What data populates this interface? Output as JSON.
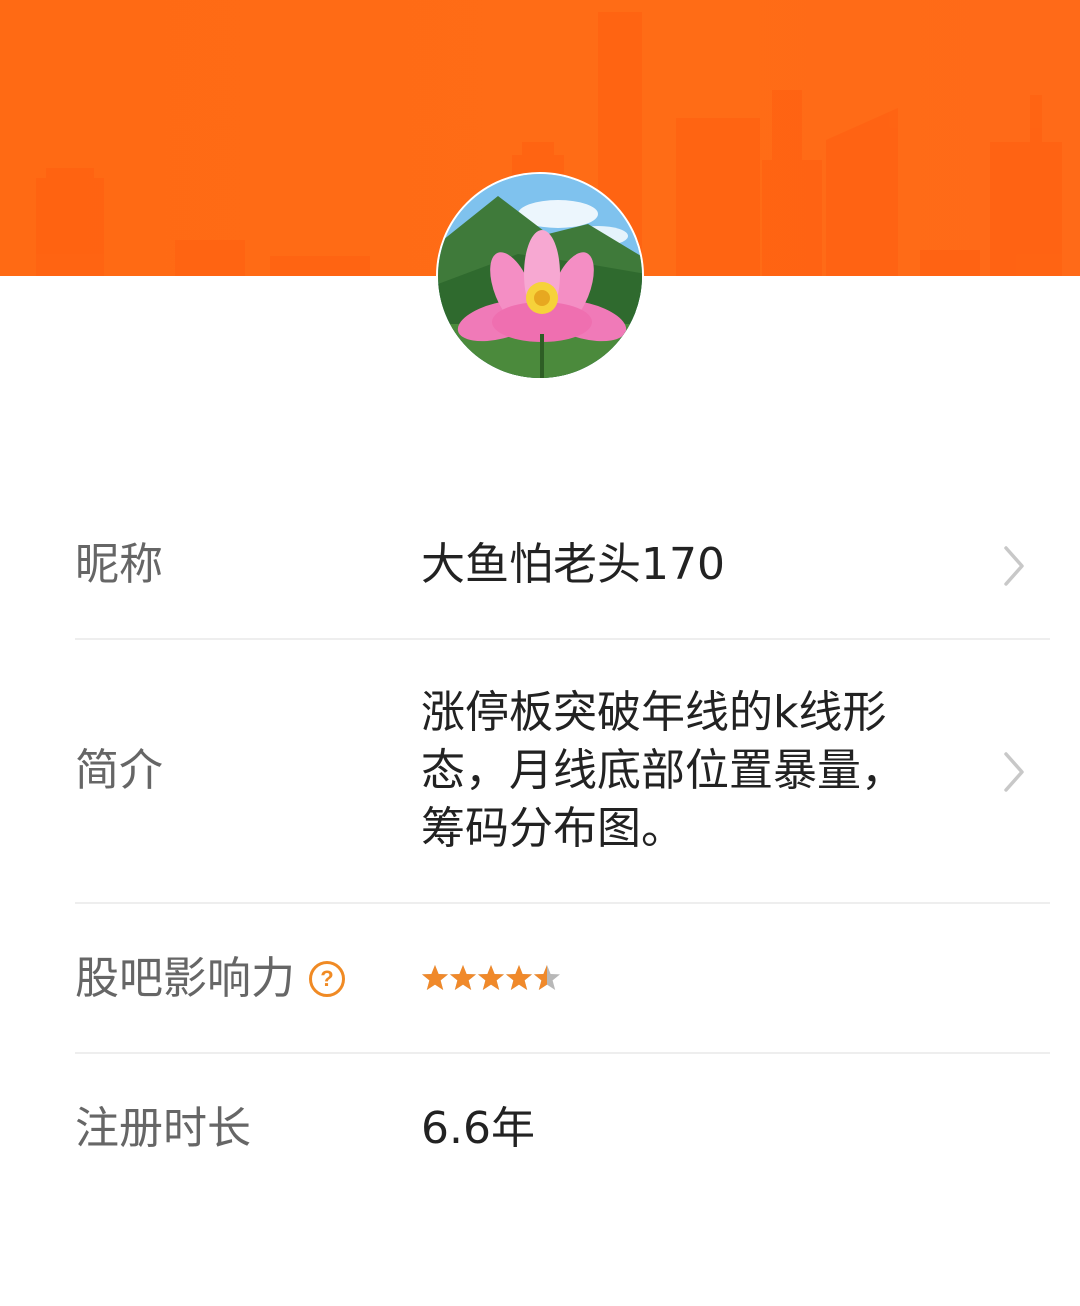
{
  "profile": {
    "nickname_label": "昵称",
    "nickname": "大鱼怕老头170",
    "intro_label": "简介",
    "intro_lines": [
      "涨停板突破年线的k线形",
      "态，月线底部位置暴量，",
      "筹码分布图。"
    ],
    "influence_label": "股吧影响力",
    "influence_help": "?",
    "influence_stars": 4.5,
    "influence_max": 5,
    "register_label": "注册时长",
    "register_value": "6.6年"
  },
  "colors": {
    "banner": "#ff6a14",
    "star_fill": "#f0892a",
    "star_empty": "#b8b8b8",
    "chevron": "#c8c8c8"
  },
  "icons": {
    "chevron": "chevron-right-icon",
    "help": "question-circle-icon",
    "star": "star-icon"
  }
}
